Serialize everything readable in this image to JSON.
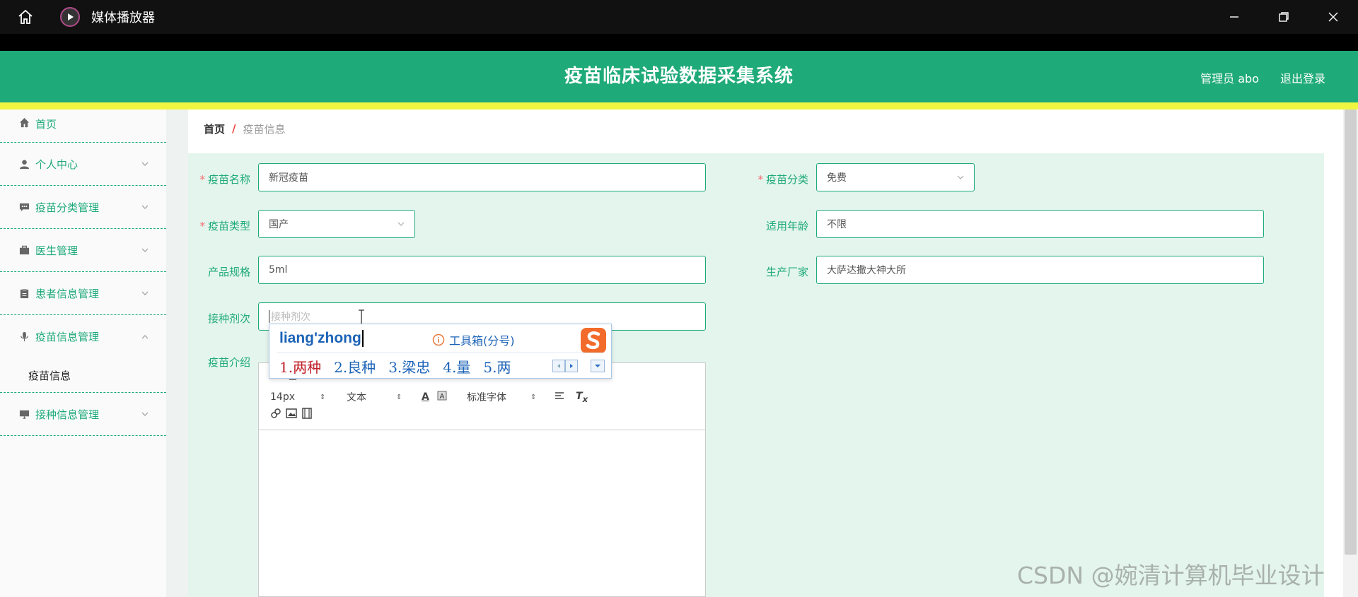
{
  "window": {
    "title": "媒体播放器",
    "icons": [
      "home-icon",
      "media-player-icon",
      "minimize-icon",
      "restore-icon",
      "close-icon"
    ]
  },
  "header": {
    "title": "疫苗临床试验数据采集系统",
    "user": "管理员 abo",
    "logout": "退出登录"
  },
  "sidebar": {
    "items": [
      {
        "label": "首页",
        "icon": "home-icon"
      },
      {
        "label": "个人中心",
        "icon": "user-icon"
      },
      {
        "label": "疫苗分类管理",
        "icon": "chat-icon"
      },
      {
        "label": "医生管理",
        "icon": "briefcase-icon"
      },
      {
        "label": "患者信息管理",
        "icon": "clipboard-icon"
      },
      {
        "label": "疫苗信息管理",
        "icon": "microphone-icon",
        "expanded": true,
        "sub": "疫苗信息"
      },
      {
        "label": "接种信息管理",
        "icon": "monitor-icon"
      }
    ]
  },
  "breadcrumb": {
    "home": "首页",
    "sep": "/",
    "current": "疫苗信息"
  },
  "form": {
    "vaccine_name": {
      "label": "疫苗名称",
      "value": "新冠疫苗"
    },
    "vaccine_category": {
      "label": "疫苗分类",
      "value": "免费"
    },
    "vaccine_type": {
      "label": "疫苗类型",
      "value": "国产"
    },
    "age": {
      "label": "适用年龄",
      "value": "不限"
    },
    "spec": {
      "label": "产品规格",
      "value": "5ml"
    },
    "manufacturer": {
      "label": "生产厂家",
      "value": "大萨达撒大神大所"
    },
    "doses": {
      "label": "接种剂次",
      "placeholder": "接种剂次"
    },
    "intro": {
      "label": "疫苗介绍"
    }
  },
  "editor": {
    "font_size": "14px",
    "block": "文本",
    "font": "标准字体"
  },
  "ime": {
    "input": "liang'zhong",
    "toolbox": "工具箱(分号)",
    "candidates": [
      "1.两种",
      "2.良种",
      "3.梁忠",
      "4.量",
      "5.两"
    ]
  },
  "watermark": "CSDN @婉清计算机毕业设计",
  "colors": {
    "primary": "#1faa7a",
    "accent_bar": "#f0f542",
    "form_bg": "#e4f5ee",
    "required": "#f56c6c"
  }
}
